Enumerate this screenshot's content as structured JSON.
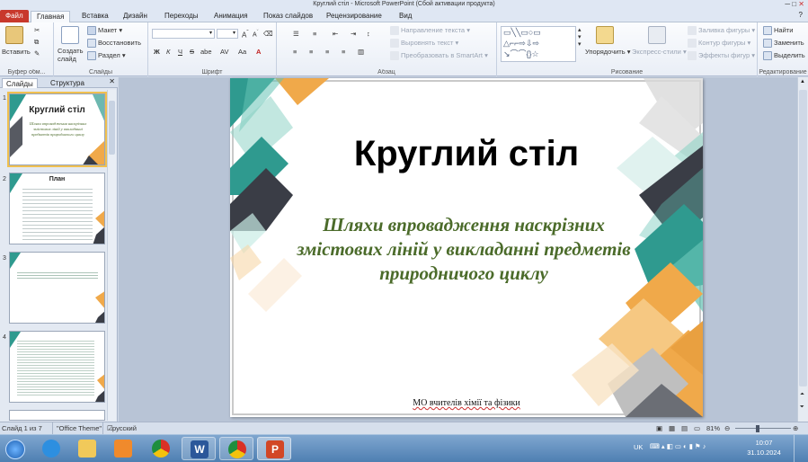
{
  "window": {
    "title": "Круглий стіл  -  Microsoft PowerPoint (Сбой активации продукта)"
  },
  "tabs": [
    "Файл",
    "Главная",
    "Вставка",
    "Дизайн",
    "Переходы",
    "Анимация",
    "Показ слайдов",
    "Рецензирование",
    "Вид"
  ],
  "ribbon": {
    "clipboard": {
      "paste": "Вставить",
      "label": "Буфер обм..."
    },
    "slides": {
      "new": "Создать слайд",
      "layout": "Макет",
      "reset": "Восстановить",
      "section": "Раздел",
      "label": "Слайды"
    },
    "font": {
      "label": "Шрифт",
      "bold": "Ж",
      "italic": "К",
      "underline": "Ч",
      "strike": "S",
      "shadow": "abe",
      "spacing": "AV",
      "case": "Aa",
      "grow": "A",
      "shrink": "A"
    },
    "paragraph": {
      "label": "Абзац",
      "direction": "Направление текста",
      "align": "Выровнять текст",
      "smartart": "Преобразовать в SmartArt"
    },
    "drawing": {
      "arrange": "Упорядочить",
      "styles": "Экспресс-стили",
      "fill": "Заливка фигуры",
      "outline": "Контур фигуры",
      "effects": "Эффекты фигур",
      "label": "Рисование"
    },
    "editing": {
      "find": "Найти",
      "replace": "Заменить",
      "select": "Выделить",
      "label": "Редактирование"
    }
  },
  "panel": {
    "tab_slides": "Слайды",
    "tab_outline": "Структура",
    "thumbs": [
      {
        "num": "1",
        "title": "Круглий стіл",
        "sub": "Шляхи впровадження наскрізних змістових ліній у викладанні предметів природничого циклу"
      },
      {
        "num": "2",
        "title": "План"
      },
      {
        "num": "3"
      },
      {
        "num": "4"
      }
    ]
  },
  "slide": {
    "title": "Круглий стіл",
    "subtitle": "Шляхи впровадження наскрізних змістових ліній у викладанні предметів природничого циклу",
    "footer": "МО вчителів  хімії  та фізики"
  },
  "status": {
    "slide": "Слайд 1 из 7",
    "theme": "\"Office Theme\"",
    "lang": "русский",
    "zoom": "81%"
  },
  "tray": {
    "lang": "UK",
    "time": "10:07",
    "date": "31.10.2024"
  },
  "colors": {
    "teal": "#2f9a8f",
    "dark": "#3a3d46",
    "orange": "#f0a94a",
    "green_text": "#4b6b2a"
  }
}
